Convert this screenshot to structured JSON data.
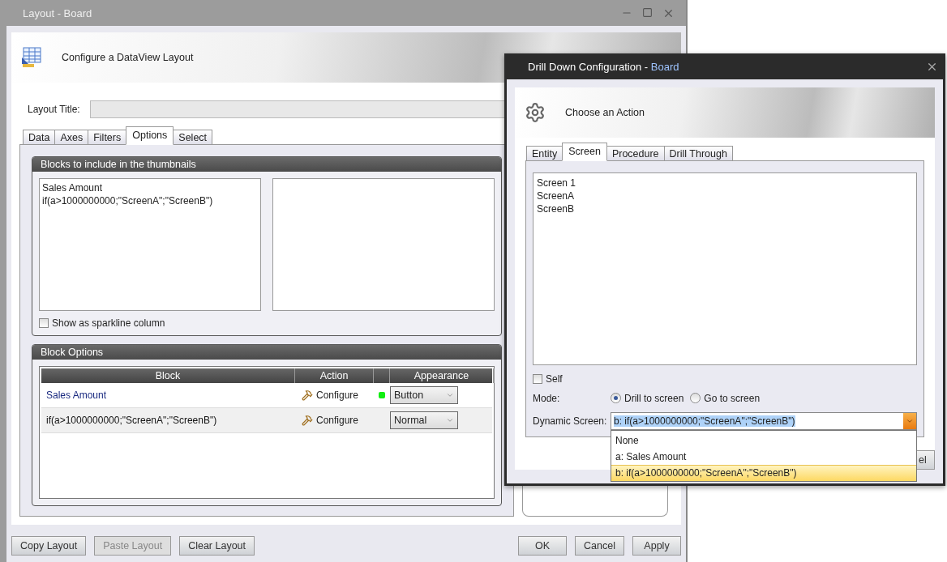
{
  "main_window": {
    "title": "Layout - Board",
    "header": "Configure a DataView Layout",
    "layout_title_label": "Layout Title:",
    "tabs": [
      {
        "label": "Data",
        "selected": false
      },
      {
        "label": "Axes",
        "selected": false
      },
      {
        "label": "Filters",
        "selected": false
      },
      {
        "label": "Options",
        "selected": true
      },
      {
        "label": "Select",
        "selected": false
      }
    ],
    "thumbnails": {
      "title": "Blocks to include in the thumbnails",
      "included": [
        "Sales Amount",
        "if(a>1000000000;\"ScreenA\";\"ScreenB\")"
      ],
      "sparkline": {
        "label": "Show as sparkline column",
        "checked": false
      }
    },
    "block_options": {
      "title": "Block Options",
      "columns": [
        "Block",
        "Action",
        "Appearance"
      ],
      "rows": [
        {
          "block": "Sales Amount",
          "action": "Configure",
          "configured": true,
          "appearance": "Button"
        },
        {
          "block": "if(a>1000000000;\"ScreenA\";\"ScreenB\")",
          "action": "Configure",
          "configured": false,
          "appearance": "Normal"
        }
      ]
    },
    "left_buttons": [
      {
        "label": "Copy Layout",
        "disabled": false
      },
      {
        "label": "Paste Layout",
        "disabled": true
      },
      {
        "label": "Clear Layout",
        "disabled": false
      }
    ],
    "right_buttons": [
      "OK",
      "Cancel",
      "Apply"
    ]
  },
  "drill_dialog": {
    "title": "Drill Down Configuration",
    "title_separator": "-",
    "title_suffix": "Board",
    "header": "Choose an Action",
    "tabs": [
      {
        "label": "Entity",
        "selected": false
      },
      {
        "label": "Screen",
        "selected": true
      },
      {
        "label": "Procedure",
        "selected": false
      },
      {
        "label": "Drill Through",
        "selected": false
      }
    ],
    "screens": [
      "Screen 1",
      "ScreenA",
      "ScreenB"
    ],
    "self": {
      "label": "Self",
      "checked": false
    },
    "mode": {
      "label": "Mode:",
      "options": [
        {
          "label": "Drill to screen",
          "selected": true
        },
        {
          "label": "Go to screen",
          "selected": false
        }
      ]
    },
    "dynamic_screen": {
      "label": "Dynamic Screen:",
      "value": "b: if(a>1000000000;\"ScreenA\";\"ScreenB\")",
      "options": [
        {
          "label": "None",
          "selected": false
        },
        {
          "label": "a: Sales Amount",
          "selected": false
        },
        {
          "label": "b: if(a>1000000000;\"ScreenA\";\"ScreenB\")",
          "selected": true
        }
      ]
    },
    "covered_button": "el"
  }
}
